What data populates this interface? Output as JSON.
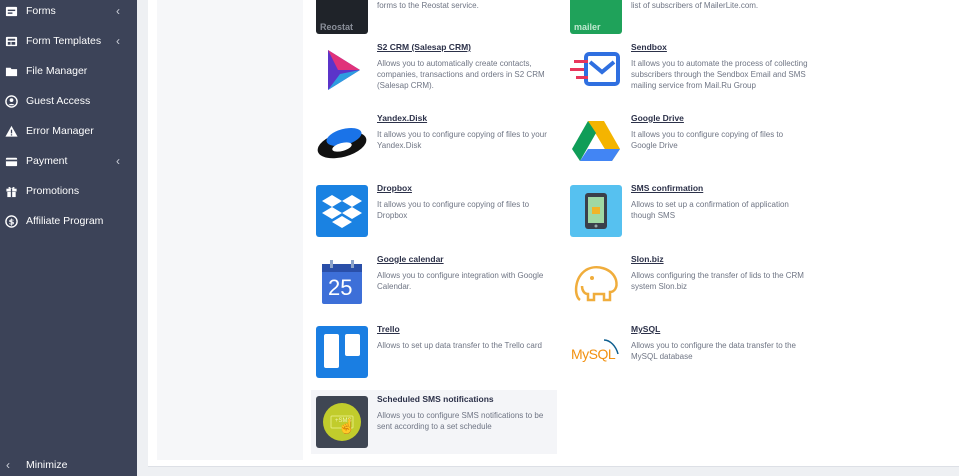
{
  "sidebar": {
    "items": [
      {
        "label": "Forms",
        "icon": "forms-icon",
        "has_submenu": true
      },
      {
        "label": "Form Templates",
        "icon": "templates-icon",
        "has_submenu": true
      },
      {
        "label": "File Manager",
        "icon": "folder-icon",
        "has_submenu": false
      },
      {
        "label": "Guest Access",
        "icon": "user-circle-icon",
        "has_submenu": false
      },
      {
        "label": "Error Manager",
        "icon": "warning-icon",
        "has_submenu": false
      },
      {
        "label": "Payment",
        "icon": "credit-card-icon",
        "has_submenu": true
      },
      {
        "label": "Promotions",
        "icon": "gift-icon",
        "has_submenu": false
      },
      {
        "label": "Affiliate Program",
        "icon": "dollar-icon",
        "has_submenu": false
      }
    ],
    "minimize_label": "Minimize",
    "colors": {
      "background": "#3c4358",
      "text": "#ffffff"
    }
  },
  "integrations": [
    {
      "title": "",
      "description": "forms to the Reostat service.",
      "logo": "reostat-logo",
      "logo_text": "Reostat"
    },
    {
      "title": "",
      "description": "list of subscribers of MailerLite.com.",
      "logo": "mailerlite-logo",
      "logo_text": "mailer"
    },
    {
      "title": "S2 CRM (Salesap CRM)",
      "description": "Allows you to automatically create contacts, companies, transactions and orders in S2 CRM (Salesap CRM).",
      "logo": "s2crm-logo"
    },
    {
      "title": "Sendbox",
      "description": "It allows you to automate the process of collecting subscribers through the Sendbox Email and SMS mailing service from Mail.Ru Group",
      "logo": "sendbox-logo"
    },
    {
      "title": "Yandex.Disk",
      "description": "It allows you to configure copying of files to your Yandex.Disk",
      "logo": "yandex-disk-logo"
    },
    {
      "title": "Google Drive",
      "description": "It allows you to configure copying of files to Google Drive",
      "logo": "google-drive-logo"
    },
    {
      "title": "Dropbox",
      "description": "It allows you to configure copying of files to Dropbox",
      "logo": "dropbox-logo"
    },
    {
      "title": "SMS confirmation",
      "description": "Allows to set up a confirmation of application though SMS",
      "logo": "sms-confirmation-logo"
    },
    {
      "title": "Google calendar",
      "description": "Allows you to configure integration with Google Calendar.",
      "logo": "google-calendar-logo",
      "logo_text": "25"
    },
    {
      "title": "Slon.biz",
      "description": "Allows configuring the transfer of lids to the CRM system Slon.biz",
      "logo": "slon-biz-logo"
    },
    {
      "title": "Trello",
      "description": "Allows to set up data transfer to the Trello card",
      "logo": "trello-logo"
    },
    {
      "title": "MySQL",
      "description": "Allows you to configure the data transfer to the MySQL database",
      "logo": "mysql-logo",
      "logo_text": "MySQL"
    },
    {
      "title": "Scheduled SMS notifications",
      "description": "Allows you to configure SMS notifications to be sent according to a set schedule",
      "logo": "scheduled-sms-logo",
      "logo_text": "+SMS"
    }
  ]
}
